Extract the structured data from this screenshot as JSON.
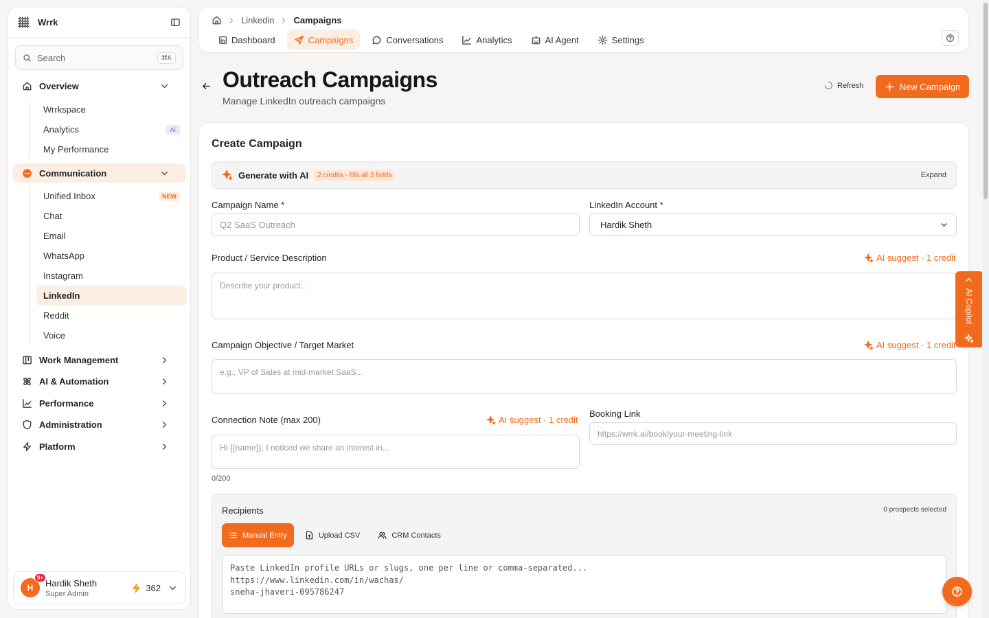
{
  "sidebar": {
    "brand": "Wrrk",
    "search": {
      "placeholder": "Search",
      "shortcut": "⌘K"
    },
    "overview": {
      "label": "Overview",
      "items": [
        {
          "label": "Wrrkspace"
        },
        {
          "label": "Analytics",
          "badge": "AI"
        },
        {
          "label": "My Performance"
        }
      ]
    },
    "communication": {
      "label": "Communication",
      "items": [
        {
          "label": "Unified Inbox",
          "badge": "NEW"
        },
        {
          "label": "Chat"
        },
        {
          "label": "Email"
        },
        {
          "label": "WhatsApp"
        },
        {
          "label": "Instagram"
        },
        {
          "label": "LinkedIn"
        },
        {
          "label": "Reddit"
        },
        {
          "label": "Voice"
        }
      ]
    },
    "sections": [
      {
        "label": "Work Management"
      },
      {
        "label": "AI & Automation"
      },
      {
        "label": "Performance"
      },
      {
        "label": "Administration"
      },
      {
        "label": "Platform"
      }
    ],
    "user": {
      "initial": "H",
      "notif": "9+",
      "name": "Hardik Sheth",
      "role": "Super Admin",
      "credits": "362"
    }
  },
  "topnav": {
    "breadcrumb": [
      "Linkedin",
      "Campaigns"
    ],
    "tabs": [
      {
        "label": "Dashboard"
      },
      {
        "label": "Campaigns"
      },
      {
        "label": "Conversations"
      },
      {
        "label": "Analytics"
      },
      {
        "label": "AI Agent"
      },
      {
        "label": "Settings"
      }
    ]
  },
  "header": {
    "title": "Outreach Campaigns",
    "subtitle": "Manage LinkedIn outreach campaigns",
    "refresh": "Refresh",
    "new_campaign": "New Campaign"
  },
  "form": {
    "title": "Create Campaign",
    "gen_ai": {
      "label": "Generate with AI",
      "credits": "2 credits · fills all 3 fields",
      "expand": "Expand"
    },
    "campaign_name": {
      "label": "Campaign Name *",
      "placeholder": "Q2 SaaS Outreach"
    },
    "linkedin_account": {
      "label": "LinkedIn Account *",
      "value": "Hardik Sheth"
    },
    "product_desc": {
      "label": "Product / Service Description",
      "placeholder": "Describe your product..."
    },
    "objective": {
      "label": "Campaign Objective / Target Market",
      "placeholder": "e.g., VP of Sales at mid-market SaaS..."
    },
    "connection_note": {
      "label": "Connection Note (max 200)",
      "placeholder": "Hi {{name}}, I noticed we share an interest in...",
      "counter": "0/200"
    },
    "booking_link": {
      "label": "Booking Link",
      "placeholder": "https://wrrk.ai/book/your-meeting-link"
    },
    "ai_suggest": "AI suggest · 1 credit",
    "recipients": {
      "title": "Recipients",
      "count": "0 prospects selected",
      "tabs": [
        {
          "label": "Manual Entry"
        },
        {
          "label": "Upload CSV"
        },
        {
          "label": "CRM Contacts"
        }
      ],
      "placeholder_lines": [
        "Paste LinkedIn profile URLs or slugs, one per line or comma-separated...",
        "https://www.linkedin.com/in/wachas/",
        "sneha-jhaveri-095786247"
      ]
    }
  },
  "copilot": {
    "label": "AI Copilot"
  },
  "colors": {
    "accent": "#f26b1d",
    "accent_soft": "#fdeee4",
    "ai_badge": "#8b63d6"
  }
}
